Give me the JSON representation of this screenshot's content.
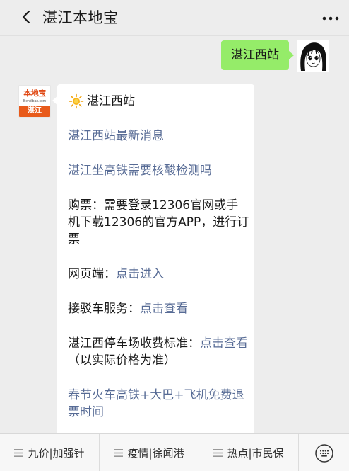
{
  "header": {
    "title": "湛江本地宝",
    "back_icon": "chevron-left-icon",
    "more_icon": "ellipsis-icon"
  },
  "outgoing": {
    "text": "湛江西站",
    "bubble_color": "#95ec69"
  },
  "incoming": {
    "avatar": {
      "logo_text": "本地宝",
      "logo_sub": "Bendibao.com",
      "city": "湛江"
    },
    "head_icon": "sun-icon",
    "head_text": "湛江西站",
    "items": [
      {
        "link": "湛江西站最新消息"
      },
      {
        "link": "湛江坐高铁需要核酸检测吗"
      },
      {
        "text": "购票：需要登录12306官网或手机下载12306的官方APP，进行订票"
      },
      {
        "prefix": "网页端：",
        "link": "点击进入"
      },
      {
        "prefix": "接驳车服务：",
        "link": "点击查看"
      },
      {
        "prefix": "湛江西停车场收费标准：",
        "link": "点击查看",
        "suffix": "（以实际价格为准）"
      },
      {
        "link": "春节火车高铁+大巴+飞机免费退票时间"
      }
    ],
    "link_color": "#576b95"
  },
  "bottom_menu": {
    "items": [
      {
        "label": "九价|加强针",
        "icon": "menu-lines-icon"
      },
      {
        "label": "疫情|徐闻港",
        "icon": "menu-lines-icon"
      },
      {
        "label": "热点|市民保",
        "icon": "menu-lines-icon"
      }
    ],
    "keyboard_icon": "keyboard-icon"
  }
}
